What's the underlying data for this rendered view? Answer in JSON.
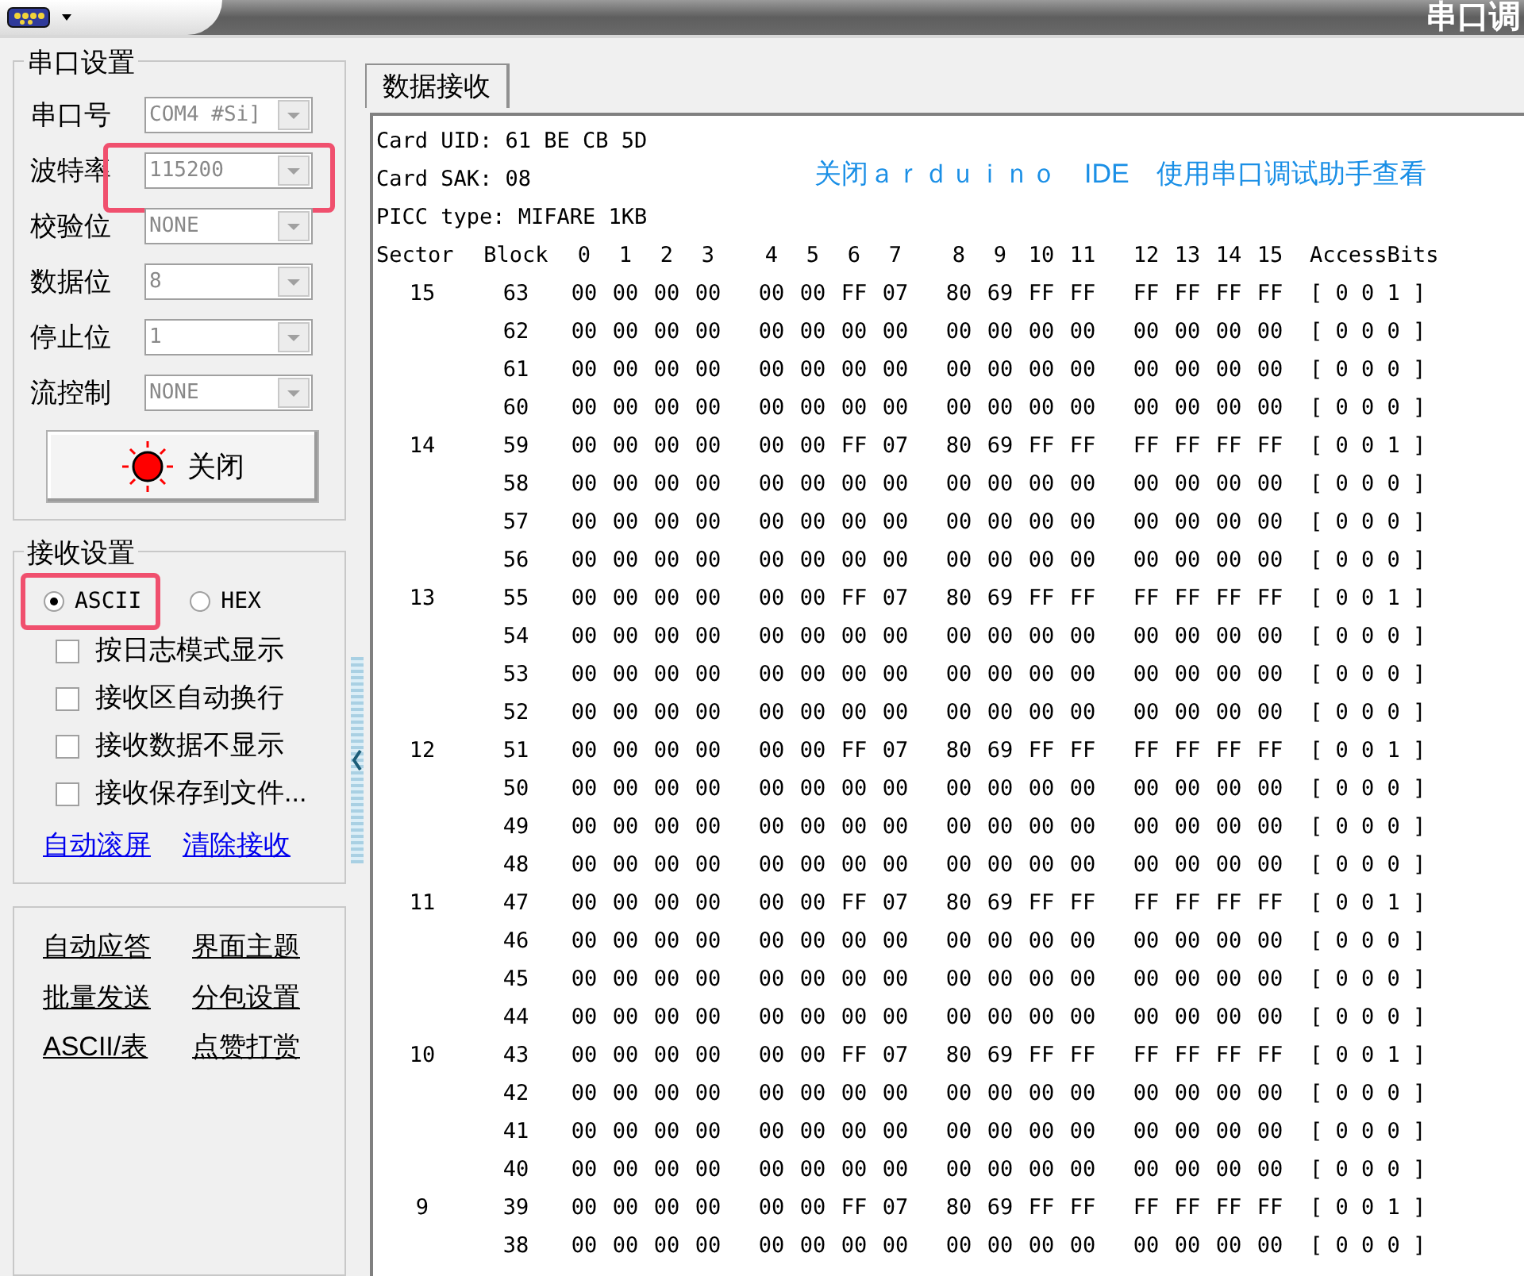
{
  "window": {
    "title": "串口调"
  },
  "serial_settings": {
    "title": "串口设置",
    "fields": [
      {
        "label": "串口号",
        "value": "COM4 #Si]",
        "highlighted": false
      },
      {
        "label": "波特率",
        "value": "115200",
        "highlighted": true
      },
      {
        "label": "校验位",
        "value": "NONE",
        "highlighted": false
      },
      {
        "label": "数据位",
        "value": "8",
        "highlighted": false
      },
      {
        "label": "停止位",
        "value": "1",
        "highlighted": false
      },
      {
        "label": "流控制",
        "value": "NONE",
        "highlighted": false
      }
    ],
    "open_button": {
      "label": "关闭",
      "on": true
    }
  },
  "receive_settings": {
    "title": "接收设置",
    "modes": [
      {
        "label": "ASCII",
        "selected": true,
        "highlighted": true
      },
      {
        "label": "HEX",
        "selected": false,
        "highlighted": false
      }
    ],
    "options": [
      {
        "label": "按日志模式显示",
        "checked": false
      },
      {
        "label": "接收区自动换行",
        "checked": false
      },
      {
        "label": "接收数据不显示",
        "checked": false
      },
      {
        "label": "接收保存到文件...",
        "checked": false
      }
    ],
    "links": [
      "自动滚屏",
      "清除接收"
    ]
  },
  "tools": {
    "links": [
      "自动应答",
      "界面主题",
      "批量发送",
      "分包设置",
      "ASCII/表",
      "点赞打赏"
    ]
  },
  "tabs": [
    {
      "label": "数据接收",
      "selected": true
    }
  ],
  "receive": {
    "lines": [
      "Card UID: 61 BE CB 5D",
      "Card SAK: 08",
      "PICC type: MIFARE 1KB"
    ],
    "annotation": "关闭ａｒｄｕｉｎｏ　IDE　使用串口调试助手查看",
    "columns": [
      "Sector",
      "Block",
      "0",
      "1",
      "2",
      "3",
      "4",
      "5",
      "6",
      "7",
      "8",
      "9",
      "10",
      "11",
      "12",
      "13",
      "14",
      "15",
      "AccessBits"
    ],
    "rows": [
      {
        "sector": "15",
        "block": "63",
        "bytes": [
          "00",
          "00",
          "00",
          "00",
          "00",
          "00",
          "FF",
          "07",
          "80",
          "69",
          "FF",
          "FF",
          "FF",
          "FF",
          "FF",
          "FF"
        ],
        "access": "[ 0 0 1 ]"
      },
      {
        "block": "62",
        "bytes": [
          "00",
          "00",
          "00",
          "00",
          "00",
          "00",
          "00",
          "00",
          "00",
          "00",
          "00",
          "00",
          "00",
          "00",
          "00",
          "00"
        ],
        "access": "[ 0 0 0 ]"
      },
      {
        "block": "61",
        "bytes": [
          "00",
          "00",
          "00",
          "00",
          "00",
          "00",
          "00",
          "00",
          "00",
          "00",
          "00",
          "00",
          "00",
          "00",
          "00",
          "00"
        ],
        "access": "[ 0 0 0 ]"
      },
      {
        "block": "60",
        "bytes": [
          "00",
          "00",
          "00",
          "00",
          "00",
          "00",
          "00",
          "00",
          "00",
          "00",
          "00",
          "00",
          "00",
          "00",
          "00",
          "00"
        ],
        "access": "[ 0 0 0 ]"
      },
      {
        "sector": "14",
        "block": "59",
        "bytes": [
          "00",
          "00",
          "00",
          "00",
          "00",
          "00",
          "FF",
          "07",
          "80",
          "69",
          "FF",
          "FF",
          "FF",
          "FF",
          "FF",
          "FF"
        ],
        "access": "[ 0 0 1 ]"
      },
      {
        "block": "58",
        "bytes": [
          "00",
          "00",
          "00",
          "00",
          "00",
          "00",
          "00",
          "00",
          "00",
          "00",
          "00",
          "00",
          "00",
          "00",
          "00",
          "00"
        ],
        "access": "[ 0 0 0 ]"
      },
      {
        "block": "57",
        "bytes": [
          "00",
          "00",
          "00",
          "00",
          "00",
          "00",
          "00",
          "00",
          "00",
          "00",
          "00",
          "00",
          "00",
          "00",
          "00",
          "00"
        ],
        "access": "[ 0 0 0 ]"
      },
      {
        "block": "56",
        "bytes": [
          "00",
          "00",
          "00",
          "00",
          "00",
          "00",
          "00",
          "00",
          "00",
          "00",
          "00",
          "00",
          "00",
          "00",
          "00",
          "00"
        ],
        "access": "[ 0 0 0 ]"
      },
      {
        "sector": "13",
        "block": "55",
        "bytes": [
          "00",
          "00",
          "00",
          "00",
          "00",
          "00",
          "FF",
          "07",
          "80",
          "69",
          "FF",
          "FF",
          "FF",
          "FF",
          "FF",
          "FF"
        ],
        "access": "[ 0 0 1 ]"
      },
      {
        "block": "54",
        "bytes": [
          "00",
          "00",
          "00",
          "00",
          "00",
          "00",
          "00",
          "00",
          "00",
          "00",
          "00",
          "00",
          "00",
          "00",
          "00",
          "00"
        ],
        "access": "[ 0 0 0 ]"
      },
      {
        "block": "53",
        "bytes": [
          "00",
          "00",
          "00",
          "00",
          "00",
          "00",
          "00",
          "00",
          "00",
          "00",
          "00",
          "00",
          "00",
          "00",
          "00",
          "00"
        ],
        "access": "[ 0 0 0 ]"
      },
      {
        "block": "52",
        "bytes": [
          "00",
          "00",
          "00",
          "00",
          "00",
          "00",
          "00",
          "00",
          "00",
          "00",
          "00",
          "00",
          "00",
          "00",
          "00",
          "00"
        ],
        "access": "[ 0 0 0 ]"
      },
      {
        "sector": "12",
        "block": "51",
        "bytes": [
          "00",
          "00",
          "00",
          "00",
          "00",
          "00",
          "FF",
          "07",
          "80",
          "69",
          "FF",
          "FF",
          "FF",
          "FF",
          "FF",
          "FF"
        ],
        "access": "[ 0 0 1 ]"
      },
      {
        "block": "50",
        "bytes": [
          "00",
          "00",
          "00",
          "00",
          "00",
          "00",
          "00",
          "00",
          "00",
          "00",
          "00",
          "00",
          "00",
          "00",
          "00",
          "00"
        ],
        "access": "[ 0 0 0 ]"
      },
      {
        "block": "49",
        "bytes": [
          "00",
          "00",
          "00",
          "00",
          "00",
          "00",
          "00",
          "00",
          "00",
          "00",
          "00",
          "00",
          "00",
          "00",
          "00",
          "00"
        ],
        "access": "[ 0 0 0 ]"
      },
      {
        "block": "48",
        "bytes": [
          "00",
          "00",
          "00",
          "00",
          "00",
          "00",
          "00",
          "00",
          "00",
          "00",
          "00",
          "00",
          "00",
          "00",
          "00",
          "00"
        ],
        "access": "[ 0 0 0 ]"
      },
      {
        "sector": "11",
        "block": "47",
        "bytes": [
          "00",
          "00",
          "00",
          "00",
          "00",
          "00",
          "FF",
          "07",
          "80",
          "69",
          "FF",
          "FF",
          "FF",
          "FF",
          "FF",
          "FF"
        ],
        "access": "[ 0 0 1 ]"
      },
      {
        "block": "46",
        "bytes": [
          "00",
          "00",
          "00",
          "00",
          "00",
          "00",
          "00",
          "00",
          "00",
          "00",
          "00",
          "00",
          "00",
          "00",
          "00",
          "00"
        ],
        "access": "[ 0 0 0 ]"
      },
      {
        "block": "45",
        "bytes": [
          "00",
          "00",
          "00",
          "00",
          "00",
          "00",
          "00",
          "00",
          "00",
          "00",
          "00",
          "00",
          "00",
          "00",
          "00",
          "00"
        ],
        "access": "[ 0 0 0 ]"
      },
      {
        "block": "44",
        "bytes": [
          "00",
          "00",
          "00",
          "00",
          "00",
          "00",
          "00",
          "00",
          "00",
          "00",
          "00",
          "00",
          "00",
          "00",
          "00",
          "00"
        ],
        "access": "[ 0 0 0 ]"
      },
      {
        "sector": "10",
        "block": "43",
        "bytes": [
          "00",
          "00",
          "00",
          "00",
          "00",
          "00",
          "FF",
          "07",
          "80",
          "69",
          "FF",
          "FF",
          "FF",
          "FF",
          "FF",
          "FF"
        ],
        "access": "[ 0 0 1 ]"
      },
      {
        "block": "42",
        "bytes": [
          "00",
          "00",
          "00",
          "00",
          "00",
          "00",
          "00",
          "00",
          "00",
          "00",
          "00",
          "00",
          "00",
          "00",
          "00",
          "00"
        ],
        "access": "[ 0 0 0 ]"
      },
      {
        "block": "41",
        "bytes": [
          "00",
          "00",
          "00",
          "00",
          "00",
          "00",
          "00",
          "00",
          "00",
          "00",
          "00",
          "00",
          "00",
          "00",
          "00",
          "00"
        ],
        "access": "[ 0 0 0 ]"
      },
      {
        "block": "40",
        "bytes": [
          "00",
          "00",
          "00",
          "00",
          "00",
          "00",
          "00",
          "00",
          "00",
          "00",
          "00",
          "00",
          "00",
          "00",
          "00",
          "00"
        ],
        "access": "[ 0 0 0 ]"
      },
      {
        "sector": "9",
        "block": "39",
        "bytes": [
          "00",
          "00",
          "00",
          "00",
          "00",
          "00",
          "FF",
          "07",
          "80",
          "69",
          "FF",
          "FF",
          "FF",
          "FF",
          "FF",
          "FF"
        ],
        "access": "[ 0 0 1 ]"
      },
      {
        "block": "38",
        "bytes": [
          "00",
          "00",
          "00",
          "00",
          "00",
          "00",
          "00",
          "00",
          "00",
          "00",
          "00",
          "00",
          "00",
          "00",
          "00",
          "00"
        ],
        "access": "[ 0 0 0 ]"
      }
    ]
  }
}
